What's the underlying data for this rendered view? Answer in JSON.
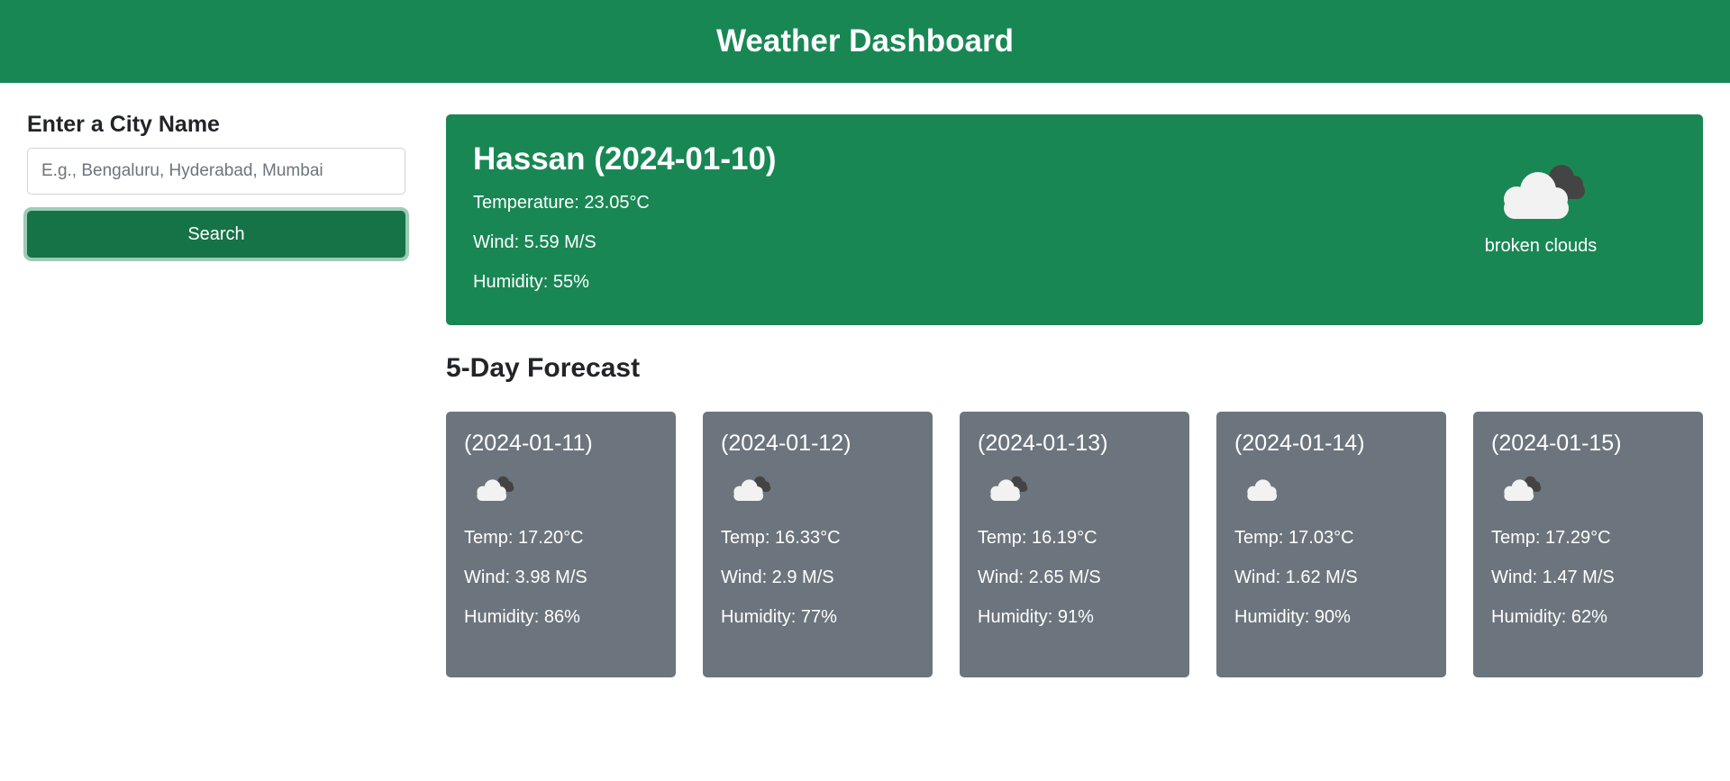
{
  "header": {
    "title": "Weather Dashboard"
  },
  "sidebar": {
    "heading": "Enter a City Name",
    "input_placeholder": "E.g., Bengaluru, Hyderabad, Mumbai",
    "input_value": "",
    "search_label": "Search"
  },
  "current": {
    "title": "Hassan (2024-01-10)",
    "temperature": "Temperature: 23.05°C",
    "wind": "Wind: 5.59 M/S",
    "humidity": "Humidity: 55%",
    "description": "broken clouds",
    "icon": "broken-clouds-icon"
  },
  "forecast": {
    "title": "5-Day Forecast",
    "days": [
      {
        "date": "(2024-01-11)",
        "temp": "Temp: 17.20°C",
        "wind": "Wind: 3.98 M/S",
        "humidity": "Humidity: 86%",
        "icon": "broken-clouds-icon"
      },
      {
        "date": "(2024-01-12)",
        "temp": "Temp: 16.33°C",
        "wind": "Wind: 2.9 M/S",
        "humidity": "Humidity: 77%",
        "icon": "broken-clouds-icon"
      },
      {
        "date": "(2024-01-13)",
        "temp": "Temp: 16.19°C",
        "wind": "Wind: 2.65 M/S",
        "humidity": "Humidity: 91%",
        "icon": "broken-clouds-icon"
      },
      {
        "date": "(2024-01-14)",
        "temp": "Temp: 17.03°C",
        "wind": "Wind: 1.62 M/S",
        "humidity": "Humidity: 90%",
        "icon": "clouds-icon"
      },
      {
        "date": "(2024-01-15)",
        "temp": "Temp: 17.29°C",
        "wind": "Wind: 1.47 M/S",
        "humidity": "Humidity: 62%",
        "icon": "broken-clouds-icon"
      }
    ]
  },
  "colors": {
    "primary": "#198754",
    "button": "#157347",
    "card": "#6c757d",
    "text": "#212529",
    "cloud_light": "#f2f2f2",
    "cloud_dark": "#444444"
  }
}
